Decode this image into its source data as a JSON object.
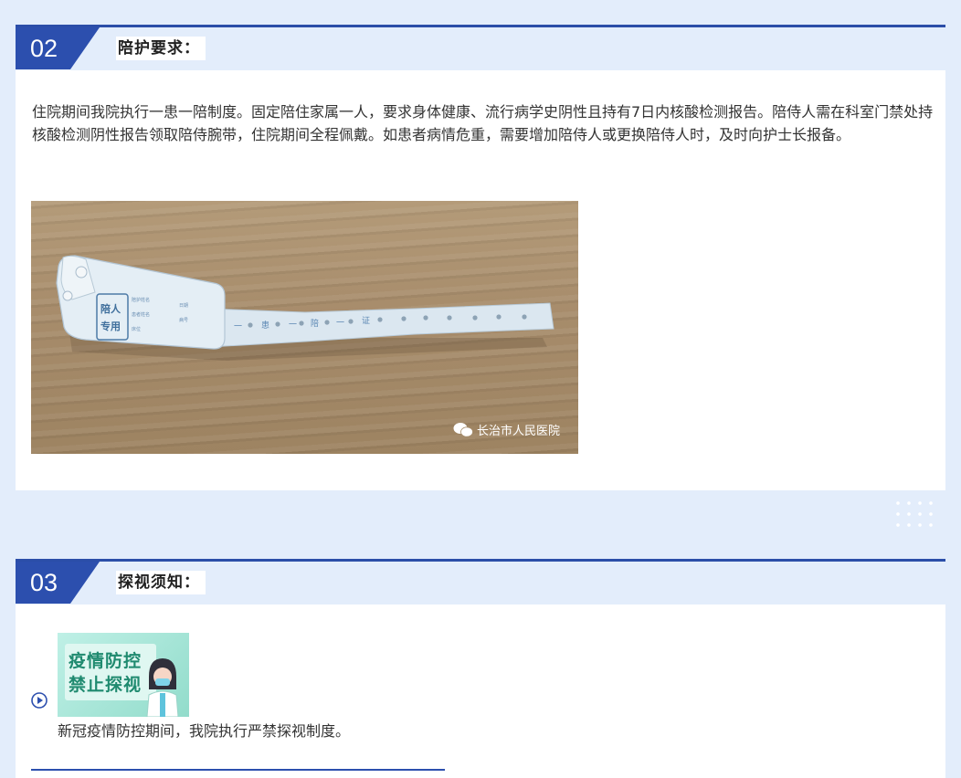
{
  "section2": {
    "number": "02",
    "title": "陪护要求：",
    "paragraph": "住院期间我院执行一患一陪制度。固定陪住家属一人，要求身体健康、流行病学史阴性且持有7日内核酸检测报告。陪侍人需在科室门禁处持核酸检测阴性报告领取陪侍腕带，住院期间全程佩戴。如患者病情危重，需要增加陪侍人或更换陪侍人时，及时向护士长报备。",
    "photo": {
      "band_label": "陪人专用",
      "band_fields": [
        "陪护姓名",
        "患者姓名",
        "日期",
        "病号",
        "床位"
      ],
      "band_chars": [
        "一",
        "患",
        "一",
        "陪",
        "一",
        "证"
      ],
      "watermark": "长治市人民医院"
    }
  },
  "section3": {
    "number": "03",
    "title": "探视须知：",
    "poster": {
      "line1": "疫情防控",
      "line2": "禁止探视"
    },
    "item_text": "新冠疫情防控期间，我院执行严禁探视制度。"
  },
  "colors": {
    "accent": "#2c4fae",
    "background": "#e3edfb",
    "card": "#ffffff"
  },
  "icons": [
    "play-circle-icon",
    "wechat-icon"
  ]
}
